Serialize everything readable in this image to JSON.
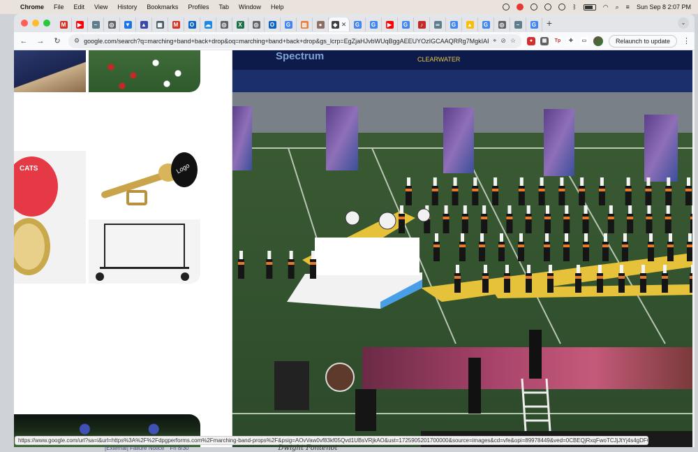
{
  "menubar": {
    "app": "Chrome",
    "items": [
      "File",
      "Edit",
      "View",
      "History",
      "Bookmarks",
      "Profiles",
      "Tab",
      "Window",
      "Help"
    ],
    "datetime": "Sun Sep 8  2:07 PM"
  },
  "tabs": {
    "favicons": [
      {
        "icon": "gmail-icon",
        "color": "#d93025",
        "glyph": "M"
      },
      {
        "icon": "youtube-icon",
        "color": "#ff0000",
        "glyph": "▶"
      },
      {
        "icon": "link-icon",
        "color": "#607d8b",
        "glyph": "–"
      },
      {
        "icon": "globe-icon",
        "color": "#5f6368",
        "glyph": "◎"
      },
      {
        "icon": "triangle-icon",
        "color": "#1a73e8",
        "glyph": "▼"
      },
      {
        "icon": "cap-icon",
        "color": "#3949ab",
        "glyph": "▲"
      },
      {
        "icon": "grid-icon",
        "color": "#455a64",
        "glyph": "▦"
      },
      {
        "icon": "gmail-icon",
        "color": "#d93025",
        "glyph": "M"
      },
      {
        "icon": "outlook-icon",
        "color": "#0a64c8",
        "glyph": "O"
      },
      {
        "icon": "cloud-icon",
        "color": "#1e88e5",
        "glyph": "☁"
      },
      {
        "icon": "globe-icon",
        "color": "#5f6368",
        "glyph": "◎"
      },
      {
        "icon": "excel-icon",
        "color": "#1e7145",
        "glyph": "X"
      },
      {
        "icon": "globe-icon",
        "color": "#5f6368",
        "glyph": "◎"
      },
      {
        "icon": "outlook-icon",
        "color": "#0a64c8",
        "glyph": "O"
      },
      {
        "icon": "google-icon",
        "color": "#4285f4",
        "glyph": "G"
      },
      {
        "icon": "image-icon",
        "color": "#e67c3c",
        "glyph": "▧"
      },
      {
        "icon": "coin-icon",
        "color": "#8d6e63",
        "glyph": "●"
      }
    ],
    "active_favicon": {
      "icon": "bird-icon",
      "color": "#3c4043",
      "glyph": "◆"
    },
    "favicons_right": [
      {
        "icon": "google-icon",
        "color": "#4285f4",
        "glyph": "G"
      },
      {
        "icon": "google-icon",
        "color": "#4285f4",
        "glyph": "G"
      },
      {
        "icon": "youtube-icon",
        "color": "#ff0000",
        "glyph": "▶"
      },
      {
        "icon": "google-icon",
        "color": "#4285f4",
        "glyph": "G"
      },
      {
        "icon": "music-icon",
        "color": "#c62828",
        "glyph": "♪"
      },
      {
        "icon": "link-icon",
        "color": "#607d8b",
        "glyph": "∞"
      },
      {
        "icon": "google-icon",
        "color": "#4285f4",
        "glyph": "G"
      },
      {
        "icon": "drive-icon",
        "color": "#fbbc04",
        "glyph": "▲"
      },
      {
        "icon": "google-icon",
        "color": "#4285f4",
        "glyph": "G"
      },
      {
        "icon": "globe-icon",
        "color": "#5f6368",
        "glyph": "◎"
      },
      {
        "icon": "link-icon",
        "color": "#607d8b",
        "glyph": "–"
      },
      {
        "icon": "google-icon",
        "color": "#4285f4",
        "glyph": "G"
      }
    ]
  },
  "toolbar": {
    "url": "google.com/search?q=marching+band+back+drop&oq=marching+band+back+drop&gs_lcrp=EgZjaHJvbWUqBggAEEUYOzIGCAAQRRg7MgkIARAAGAoYgA...",
    "relaunch_label": "Relaunch to update"
  },
  "status_url": "https://www.google.com/url?sa=i&url=https%3A%2F%2Fdpgperforms.com%2Fmarching-band-props%2F&psig=AOvVaw0vf83kf05Qvd1UBsVRjkAO&ust=1725905201700000&source=images&cd=vfe&opi=89978449&ved=0CBEQjRxqFwoTCJjJtYj4s4gDFQAAAAAdAAAAABAE",
  "preview": {
    "stadium_sign_1": "Spectrum",
    "stadium_sign_2": "CLEARWATER"
  },
  "thumbs": {
    "logo_text": "Logo",
    "badge_text": "CATS"
  },
  "below_window": {
    "notice": "[External] Failure Notice",
    "date": "Fri 8/30",
    "signature": "Dwight Fontenot"
  }
}
